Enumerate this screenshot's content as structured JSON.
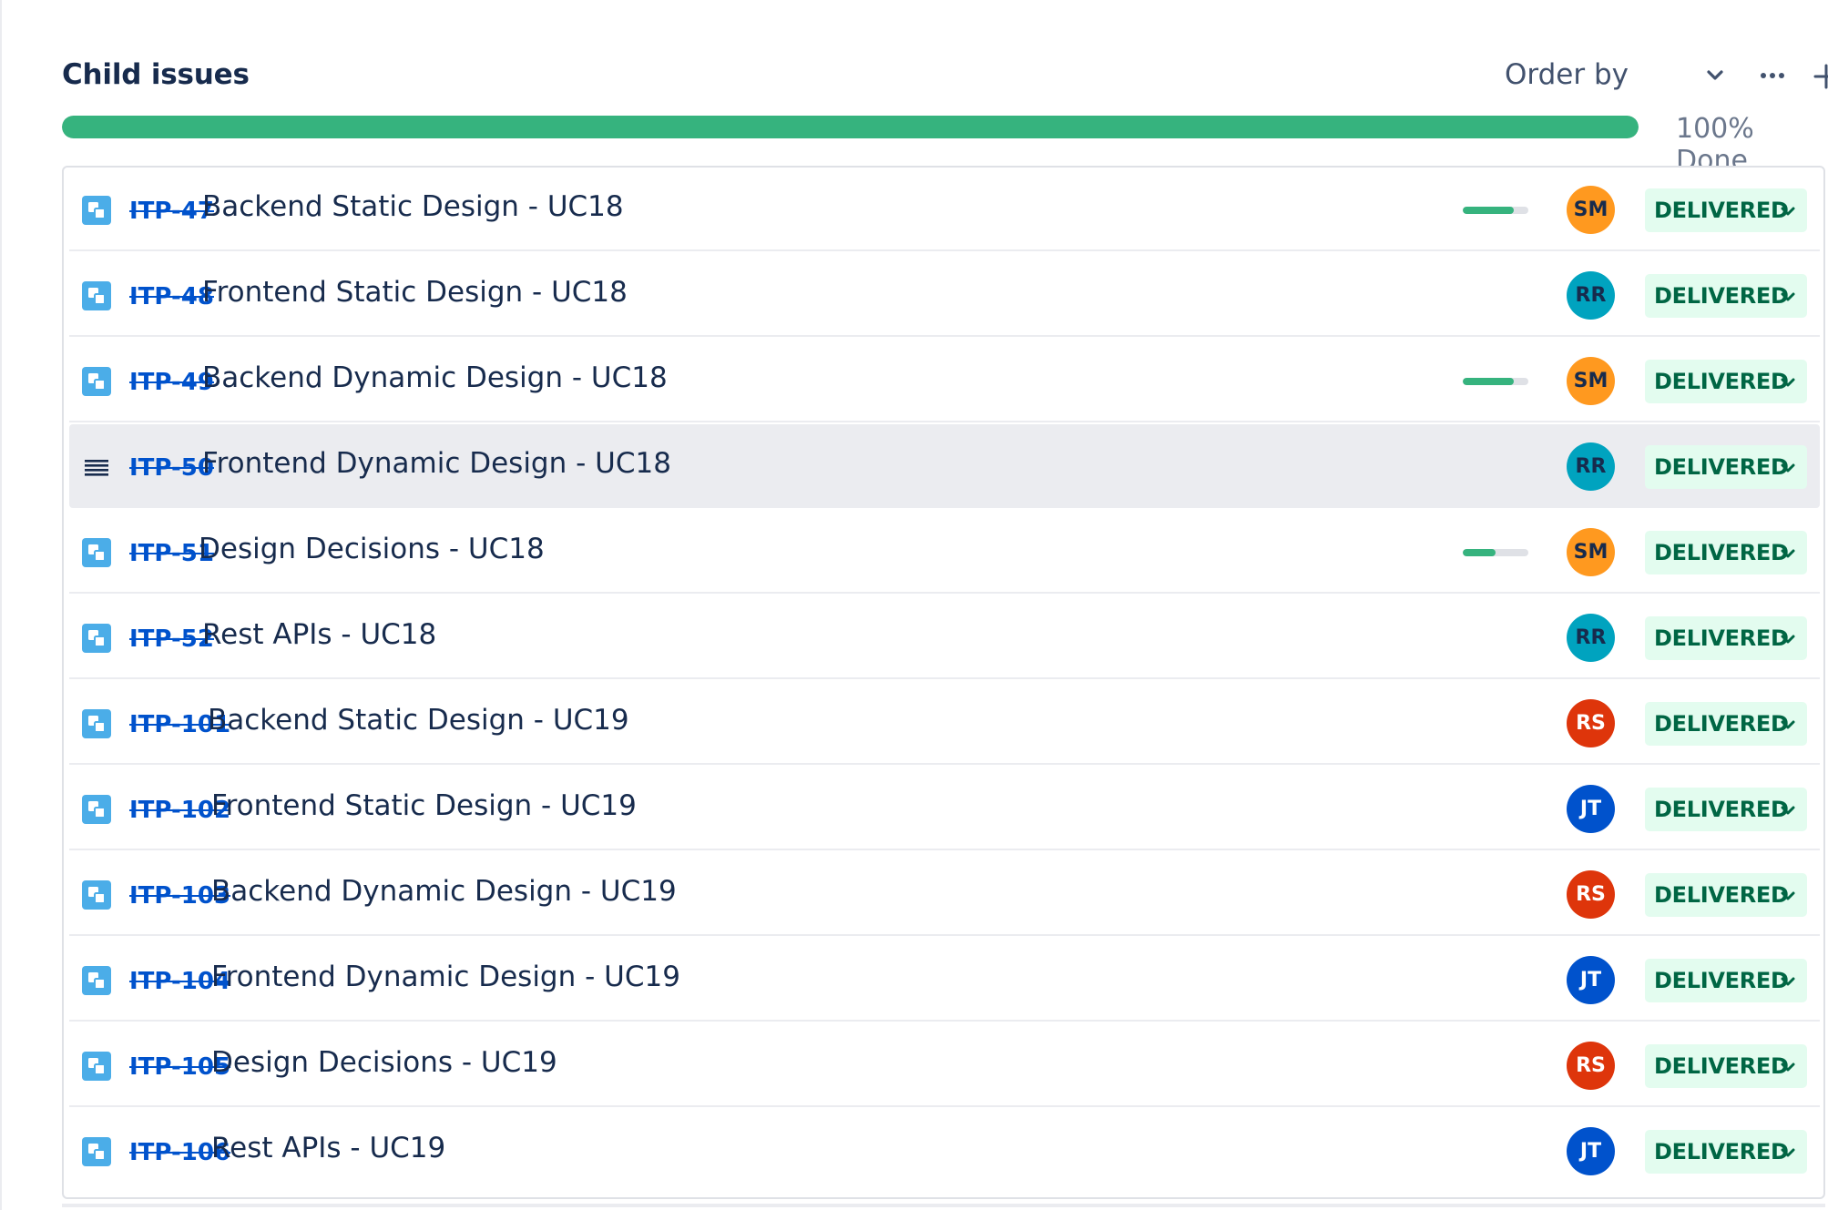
{
  "header": {
    "title": "Child issues",
    "order_by_label": "Order by",
    "progress_text": "100% Done",
    "progress_fraction": 1.0
  },
  "colors": {
    "progress_green": "#36b37e",
    "link_blue": "#0052cc",
    "status_bg": "#e3fcef",
    "status_text": "#006644",
    "hover_row_bg": "#ebecf0"
  },
  "issues": [
    {
      "key": "ITP-47",
      "summary": "Backend Static Design - UC18",
      "type_icon": "subtask-icon",
      "progress": 0.78,
      "assignee": "SM",
      "avatar_bg": "#ff991f",
      "avatar_fg": "#172b4d",
      "status": "DELIVERED"
    },
    {
      "key": "ITP-48",
      "summary": "Frontend Static Design - UC18",
      "type_icon": "subtask-icon",
      "progress": null,
      "assignee": "RR",
      "avatar_bg": "#00a3bf",
      "avatar_fg": "#172b4d",
      "status": "DELIVERED"
    },
    {
      "key": "ITP-49",
      "summary": "Backend Dynamic Design - UC18",
      "type_icon": "subtask-icon",
      "progress": 0.78,
      "assignee": "SM",
      "avatar_bg": "#ff991f",
      "avatar_fg": "#172b4d",
      "status": "DELIVERED"
    },
    {
      "key": "ITP-50",
      "summary": "Frontend Dynamic Design - UC18",
      "type_icon": "drag-handle-icon",
      "progress": null,
      "assignee": "RR",
      "avatar_bg": "#00a3bf",
      "avatar_fg": "#172b4d",
      "status": "DELIVERED",
      "hovered": true
    },
    {
      "key": "ITP-51",
      "summary": "Design Decisions - UC18",
      "type_icon": "subtask-icon",
      "progress": 0.5,
      "assignee": "SM",
      "avatar_bg": "#ff991f",
      "avatar_fg": "#172b4d",
      "status": "DELIVERED"
    },
    {
      "key": "ITP-52",
      "summary": "Rest APIs - UC18",
      "type_icon": "subtask-icon",
      "progress": null,
      "assignee": "RR",
      "avatar_bg": "#00a3bf",
      "avatar_fg": "#172b4d",
      "status": "DELIVERED"
    },
    {
      "key": "ITP-101",
      "summary": "Backend Static Design - UC19",
      "type_icon": "subtask-icon",
      "progress": null,
      "assignee": "RS",
      "avatar_bg": "#de350b",
      "avatar_fg": "#ffffff",
      "status": "DELIVERED"
    },
    {
      "key": "ITP-102",
      "summary": "Frontend Static Design - UC19",
      "type_icon": "subtask-icon",
      "progress": null,
      "assignee": "JT",
      "avatar_bg": "#0052cc",
      "avatar_fg": "#ffffff",
      "status": "DELIVERED"
    },
    {
      "key": "ITP-103",
      "summary": "Backend Dynamic Design - UC19",
      "type_icon": "subtask-icon",
      "progress": null,
      "assignee": "RS",
      "avatar_bg": "#de350b",
      "avatar_fg": "#ffffff",
      "status": "DELIVERED"
    },
    {
      "key": "ITP-104",
      "summary": "Frontend Dynamic Design - UC19",
      "type_icon": "subtask-icon",
      "progress": null,
      "assignee": "JT",
      "avatar_bg": "#0052cc",
      "avatar_fg": "#ffffff",
      "status": "DELIVERED"
    },
    {
      "key": "ITP-105",
      "summary": "Design Decisions - UC19",
      "type_icon": "subtask-icon",
      "progress": null,
      "assignee": "RS",
      "avatar_bg": "#de350b",
      "avatar_fg": "#ffffff",
      "status": "DELIVERED"
    },
    {
      "key": "ITP-106",
      "summary": "Rest APIs - UC19",
      "type_icon": "subtask-icon",
      "progress": null,
      "assignee": "JT",
      "avatar_bg": "#0052cc",
      "avatar_fg": "#ffffff",
      "status": "DELIVERED"
    }
  ]
}
